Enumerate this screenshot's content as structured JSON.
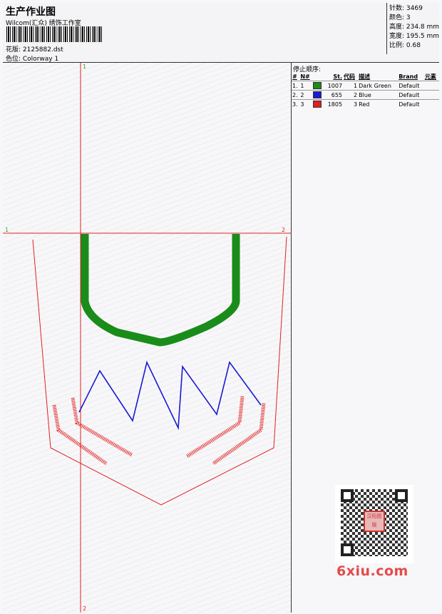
{
  "header": {
    "title": "生产作业图",
    "company": "Wilcom(汇众) 绣饰工作室",
    "design_label": "花版: 2125882.dst",
    "colorway_label": "色位:  Colorway 1"
  },
  "stats": {
    "stitches": "针数: 3469",
    "colors": "颜色: 3",
    "height": "高度: 234.8 mm",
    "width": "宽度: 195.5 mm",
    "scale": "比例: 0.68"
  },
  "guides": {
    "v_top": "1",
    "v_bottom": "2",
    "h_left": "1",
    "h_right": "2"
  },
  "stop_sequence": {
    "title": "停止顺序:",
    "headers": [
      "#",
      "N#",
      "St.",
      "代码",
      "描述",
      "Brand",
      "元素"
    ],
    "rows": [
      {
        "num": "1.",
        "n": "1",
        "swatch": "#1a8c1a",
        "st": "1007",
        "code": "1",
        "desc": "Dark Green",
        "brand": "Default"
      },
      {
        "num": "2.",
        "n": "2",
        "swatch": "#1a1ad6",
        "st": "655",
        "code": "2",
        "desc": "Blue",
        "brand": "Default"
      },
      {
        "num": "3.",
        "n": "3",
        "swatch": "#e02020",
        "st": "1805",
        "code": "3",
        "desc": "Red",
        "brand": "Default"
      }
    ]
  },
  "colors": {
    "green": "#1a8c1a",
    "blue": "#1a1ad6",
    "red": "#e02020"
  },
  "watermark": {
    "text": "6xiu.com",
    "qr_label": "汉阳图版"
  }
}
